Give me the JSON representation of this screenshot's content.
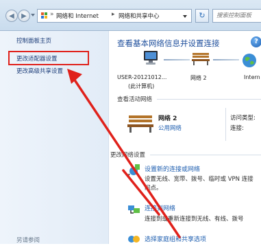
{
  "titlebar": {
    "address_segments": [
      "网络和 Internet",
      "网络和共享中心"
    ],
    "search_placeholder": "搜索控制面板"
  },
  "sidebar": {
    "items": [
      {
        "label": "控制面板主页"
      },
      {
        "label": "更改适配器设置"
      },
      {
        "label": "更改高级共享设置"
      }
    ],
    "see_also": "另请参阅",
    "highlight_color": "#e0211b"
  },
  "main": {
    "title": "查看基本网络信息并设置连接",
    "map": {
      "computer": "USER-20121012...",
      "computer_sub": "(此计算机)",
      "network": "网络  2",
      "internet": "Intern"
    },
    "active_title": "查看活动网络",
    "network": {
      "name": "网络  2",
      "type": "公用网络",
      "access_label": "访问类型:",
      "conn_label": "连接:"
    },
    "change_title": "更改网络设置",
    "tasks": [
      {
        "link": "设置新的连接或网络",
        "desc1": "设置无线、宽带、拨号、临时或 VPN 连接",
        "desc2": "问点。"
      },
      {
        "link": "连接到网络",
        "desc1": "连接到或重新连接到无线、有线、拨号"
      },
      {
        "link": "选择家庭组和共享选项"
      }
    ]
  },
  "colors": {
    "accent": "#1f5fb0",
    "annotation": "#e0211b"
  }
}
